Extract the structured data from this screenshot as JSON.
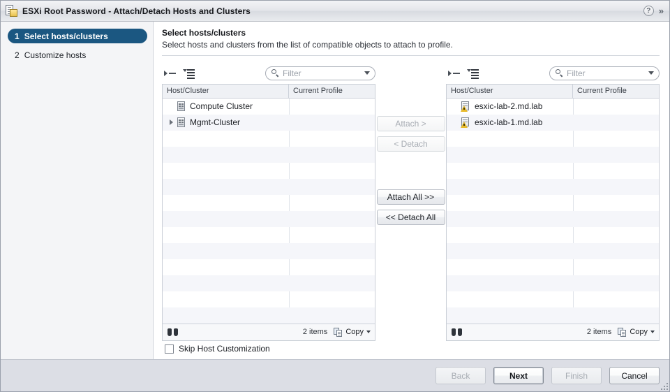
{
  "window": {
    "title": "ESXi Root Password - Attach/Detach Hosts and Clusters",
    "title_icon": "profile-document-icon",
    "help_icon": "?",
    "expand_icon": "»"
  },
  "sidebar": {
    "steps": [
      {
        "num": "1",
        "label": "Select hosts/clusters",
        "active": true
      },
      {
        "num": "2",
        "label": "Customize hosts",
        "active": false
      }
    ]
  },
  "content": {
    "title": "Select hosts/clusters",
    "subtitle": "Select hosts and clusters from the list of compatible objects to attach to profile.",
    "skip_checkbox_label": "Skip Host Customization",
    "skip_checked": false
  },
  "left_panel": {
    "toolbar_icons": [
      "expand-tree-icon",
      "list-menu-icon"
    ],
    "filter_placeholder": "Filter",
    "filter_value": "",
    "columns": [
      "Host/Cluster",
      "Current Profile"
    ],
    "rows": [
      {
        "name": "Compute Cluster",
        "profile": "",
        "icon": "cluster-icon",
        "twisty": "none"
      },
      {
        "name": "Mgmt-Cluster",
        "profile": "",
        "icon": "cluster-icon",
        "twisty": "closed"
      }
    ],
    "footer": {
      "find_icon": "binoculars-icon",
      "items_count": "2 items",
      "copy_label": "Copy"
    }
  },
  "right_panel": {
    "toolbar_icons": [
      "expand-tree-icon",
      "list-menu-icon"
    ],
    "filter_placeholder": "Filter",
    "filter_value": "",
    "columns": [
      "Host/Cluster",
      "Current Profile"
    ],
    "rows": [
      {
        "name": "esxic-lab-2.md.lab",
        "profile": "",
        "icon": "host-warning-icon",
        "twisty": "none"
      },
      {
        "name": "esxic-lab-1.md.lab",
        "profile": "",
        "icon": "host-warning-icon",
        "twisty": "none"
      }
    ],
    "footer": {
      "find_icon": "binoculars-icon",
      "items_count": "2 items",
      "copy_label": "Copy"
    }
  },
  "transfer_buttons": [
    {
      "label": "Attach >",
      "enabled": false
    },
    {
      "label": "< Detach",
      "enabled": false
    },
    {
      "label": "Attach All >>",
      "enabled": true
    },
    {
      "label": "<< Detach All",
      "enabled": true
    }
  ],
  "footer_buttons": [
    {
      "label": "Back",
      "enabled": false,
      "default": false
    },
    {
      "label": "Next",
      "enabled": true,
      "default": true
    },
    {
      "label": "Finish",
      "enabled": false,
      "default": false
    },
    {
      "label": "Cancel",
      "enabled": true,
      "default": false
    }
  ],
  "colors": {
    "accent": "#1b5781",
    "titlebar": "#e4e6ea",
    "footer": "#dcdee5",
    "row_alt": "#f5f6fa",
    "warning": "#e8bb2c"
  }
}
